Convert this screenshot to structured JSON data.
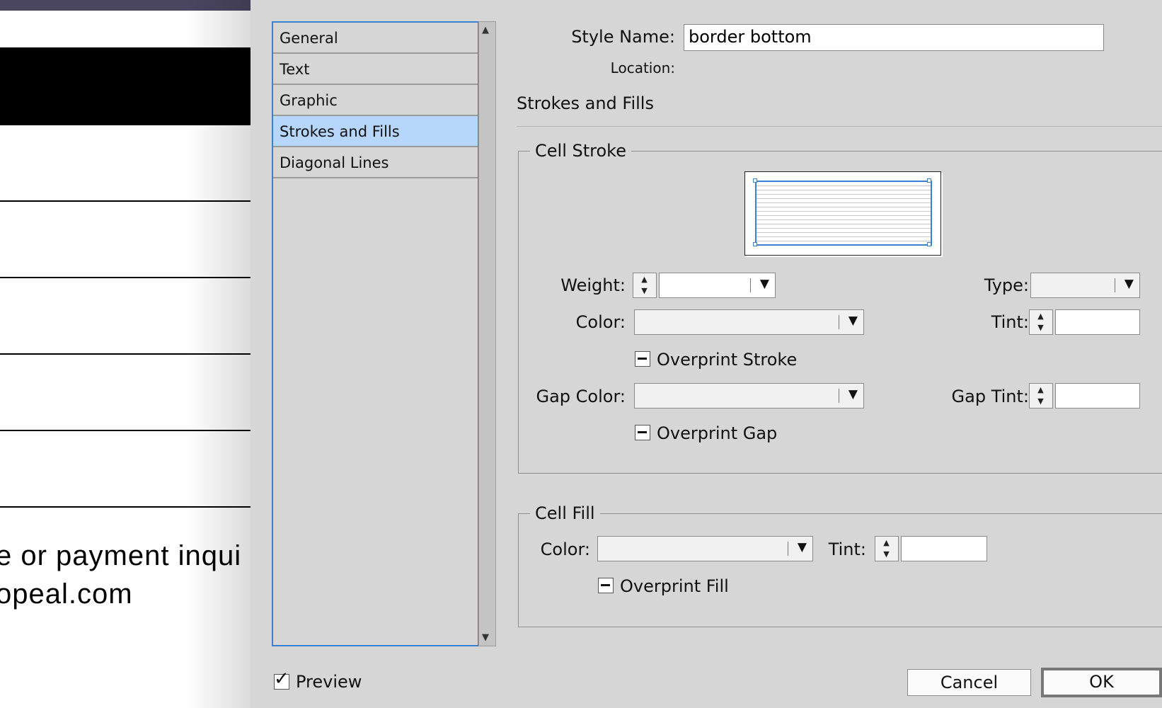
{
  "document": {
    "text_line1": "e or payment inqui",
    "text_line2": "opeal.com"
  },
  "dialog": {
    "categories": [
      {
        "label": "General"
      },
      {
        "label": "Text"
      },
      {
        "label": "Graphic"
      },
      {
        "label": "Strokes and Fills",
        "selected": true
      },
      {
        "label": "Diagonal Lines"
      }
    ],
    "style_name_label": "Style Name:",
    "style_name_value": "border bottom",
    "location_label": "Location:",
    "section_title": "Strokes and Fills",
    "cell_stroke": {
      "title": "Cell Stroke",
      "weight_label": "Weight:",
      "weight_value": "",
      "type_label": "Type:",
      "type_value": "",
      "color_label": "Color:",
      "color_value": "",
      "tint_label": "Tint:",
      "tint_value": "",
      "overprint_stroke_label": "Overprint Stroke",
      "gap_color_label": "Gap Color:",
      "gap_color_value": "",
      "gap_tint_label": "Gap Tint:",
      "gap_tint_value": "",
      "overprint_gap_label": "Overprint Gap"
    },
    "cell_fill": {
      "title": "Cell Fill",
      "color_label": "Color:",
      "color_value": "",
      "tint_label": "Tint:",
      "tint_value": "",
      "overprint_fill_label": "Overprint Fill"
    },
    "preview_label": "Preview",
    "preview_checked": true,
    "cancel_label": "Cancel",
    "ok_label": "OK"
  },
  "colors": {
    "selection": "#b6d6fb",
    "focus_ring": "#3b7fd1",
    "dialog_bg": "#d6d6d6",
    "document_header": "#4a4660"
  },
  "icons": {
    "scroll_up": "triangle-up",
    "scroll_down": "triangle-down",
    "dropdown": "triangle-down",
    "stepper": "up-down-arrows",
    "mixed_checkbox": "dash",
    "checked": "check-mark"
  }
}
